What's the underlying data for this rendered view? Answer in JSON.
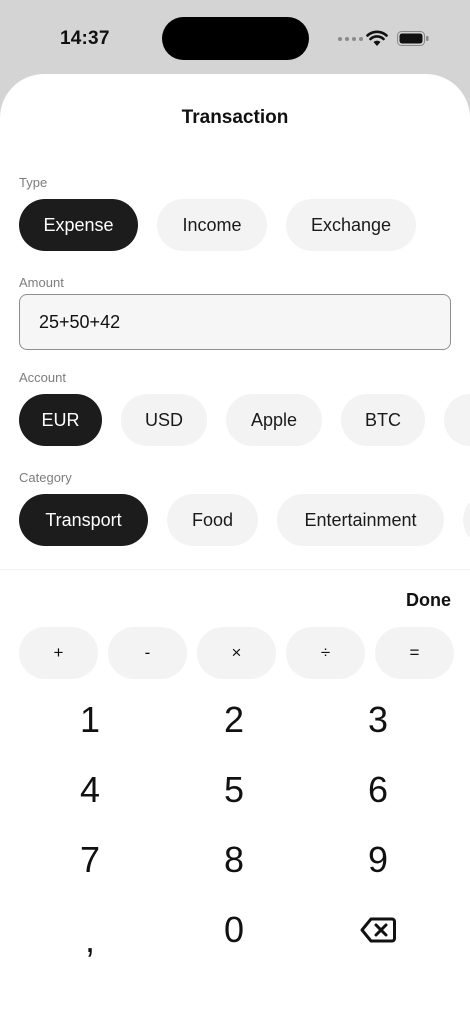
{
  "status_bar": {
    "time": "14:37"
  },
  "sheet": {
    "title": "Transaction"
  },
  "type_section": {
    "label": "Type",
    "options": [
      {
        "label": "Expense",
        "selected": true
      },
      {
        "label": "Income",
        "selected": false
      },
      {
        "label": "Exchange",
        "selected": false
      }
    ]
  },
  "amount_section": {
    "label": "Amount",
    "value": "25+50+42"
  },
  "account_section": {
    "label": "Account",
    "options": [
      {
        "label": "EUR",
        "selected": true
      },
      {
        "label": "USD",
        "selected": false
      },
      {
        "label": "Apple",
        "selected": false
      },
      {
        "label": "BTC",
        "selected": false
      }
    ]
  },
  "category_section": {
    "label": "Category",
    "options": [
      {
        "label": "Transport",
        "selected": true
      },
      {
        "label": "Food",
        "selected": false
      },
      {
        "label": "Entertainment",
        "selected": false
      }
    ]
  },
  "keyboard": {
    "done_label": "Done",
    "operators": [
      "+",
      "-",
      "×",
      "÷",
      "="
    ],
    "digits": [
      "1",
      "2",
      "3",
      "4",
      "5",
      "6",
      "7",
      "8",
      "9",
      ",",
      "0"
    ],
    "backspace_icon": "delete-left-icon"
  },
  "colors": {
    "selected_pill": "#1c1c1c",
    "pill": "#f3f3f3",
    "sheet_bg": "#ffffff",
    "backdrop": "#d4d4d4"
  }
}
